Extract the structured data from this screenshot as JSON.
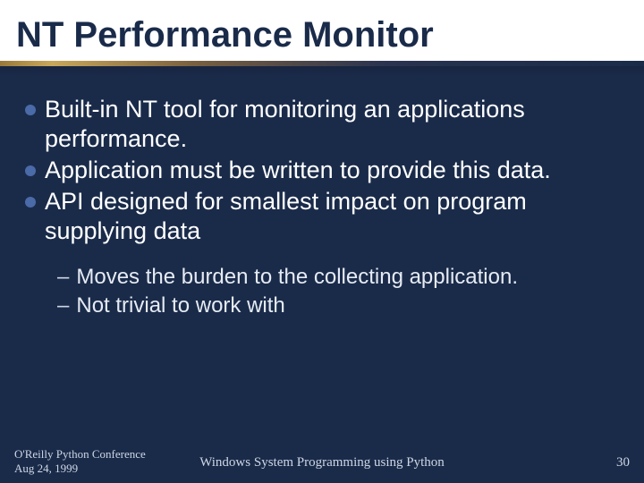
{
  "slide": {
    "title": "NT Performance Monitor",
    "bullets": [
      "Built-in NT tool for monitoring an applications performance.",
      "Application must be written to provide this data.",
      "API designed for smallest impact on program supplying data"
    ],
    "sub_bullets": [
      "Moves the burden to the collecting application.",
      "Not trivial to work with"
    ]
  },
  "footer": {
    "left_line1": "O'Reilly Python Conference",
    "left_line2": "Aug 24, 1999",
    "center": "Windows System Programming using Python",
    "page": "30"
  }
}
